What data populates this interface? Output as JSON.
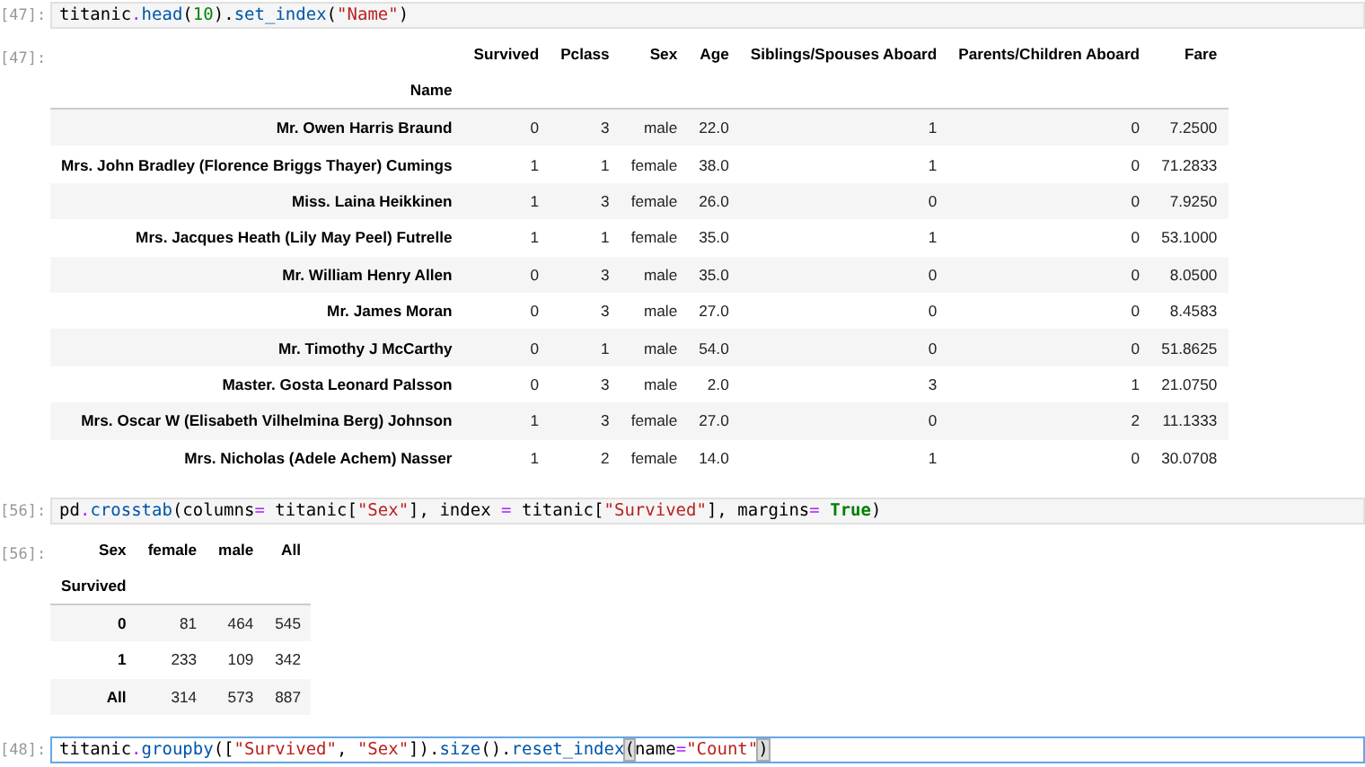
{
  "cells": [
    {
      "prompt": "[47]:",
      "selected": false,
      "code": [
        {
          "text": "titanic",
          "kind": "name"
        },
        {
          "text": ".",
          "kind": "op"
        },
        {
          "text": "head",
          "kind": "call"
        },
        {
          "text": "(",
          "kind": "punct"
        },
        {
          "text": "10",
          "kind": "number"
        },
        {
          "text": ").",
          "kind": "punct"
        },
        {
          "text": "set_index",
          "kind": "call"
        },
        {
          "text": "(",
          "kind": "punct"
        },
        {
          "text": "\"Name\"",
          "kind": "string"
        },
        {
          "text": ")",
          "kind": "punct"
        }
      ],
      "output": {
        "prompt": "[47]:",
        "table": {
          "columns": [
            "Survived",
            "Pclass",
            "Sex",
            "Age",
            "Siblings/Spouses Aboard",
            "Parents/Children Aboard",
            "Fare"
          ],
          "index_name": "Name",
          "rows": [
            {
              "index": "Mr. Owen Harris Braund",
              "cells": [
                "0",
                "3",
                "male",
                "22.0",
                "1",
                "0",
                "7.2500"
              ]
            },
            {
              "index": "Mrs. John Bradley (Florence Briggs Thayer) Cumings",
              "cells": [
                "1",
                "1",
                "female",
                "38.0",
                "1",
                "0",
                "71.2833"
              ]
            },
            {
              "index": "Miss. Laina Heikkinen",
              "cells": [
                "1",
                "3",
                "female",
                "26.0",
                "0",
                "0",
                "7.9250"
              ]
            },
            {
              "index": "Mrs. Jacques Heath (Lily May Peel) Futrelle",
              "cells": [
                "1",
                "1",
                "female",
                "35.0",
                "1",
                "0",
                "53.1000"
              ]
            },
            {
              "index": "Mr. William Henry Allen",
              "cells": [
                "0",
                "3",
                "male",
                "35.0",
                "0",
                "0",
                "8.0500"
              ]
            },
            {
              "index": "Mr. James Moran",
              "cells": [
                "0",
                "3",
                "male",
                "27.0",
                "0",
                "0",
                "8.4583"
              ]
            },
            {
              "index": "Mr. Timothy J McCarthy",
              "cells": [
                "0",
                "1",
                "male",
                "54.0",
                "0",
                "0",
                "51.8625"
              ]
            },
            {
              "index": "Master. Gosta Leonard Palsson",
              "cells": [
                "0",
                "3",
                "male",
                "2.0",
                "3",
                "1",
                "21.0750"
              ]
            },
            {
              "index": "Mrs. Oscar W (Elisabeth Vilhelmina Berg) Johnson",
              "cells": [
                "1",
                "3",
                "female",
                "27.0",
                "0",
                "2",
                "11.1333"
              ]
            },
            {
              "index": "Mrs. Nicholas (Adele Achem) Nasser",
              "cells": [
                "1",
                "2",
                "female",
                "14.0",
                "1",
                "0",
                "30.0708"
              ]
            }
          ]
        }
      }
    },
    {
      "prompt": "[56]:",
      "selected": false,
      "code": [
        {
          "text": "pd",
          "kind": "name"
        },
        {
          "text": ".",
          "kind": "op"
        },
        {
          "text": "crosstab",
          "kind": "call"
        },
        {
          "text": "(columns",
          "kind": "punct"
        },
        {
          "text": "=",
          "kind": "op"
        },
        {
          "text": " titanic[",
          "kind": "punct"
        },
        {
          "text": "\"Sex\"",
          "kind": "string"
        },
        {
          "text": "], index ",
          "kind": "punct"
        },
        {
          "text": "=",
          "kind": "op"
        },
        {
          "text": " titanic[",
          "kind": "punct"
        },
        {
          "text": "\"Survived\"",
          "kind": "string"
        },
        {
          "text": "], margins",
          "kind": "punct"
        },
        {
          "text": "=",
          "kind": "op"
        },
        {
          "text": " True",
          "kind": "keyword"
        },
        {
          "text": ")",
          "kind": "punct"
        }
      ],
      "output": {
        "prompt": "[56]:",
        "table": {
          "columns_label": "Sex",
          "columns": [
            "female",
            "male",
            "All"
          ],
          "index_name": "Survived",
          "rows": [
            {
              "index": "0",
              "cells": [
                "81",
                "464",
                "545"
              ]
            },
            {
              "index": "1",
              "cells": [
                "233",
                "109",
                "342"
              ]
            },
            {
              "index": "All",
              "cells": [
                "314",
                "573",
                "887"
              ]
            }
          ]
        }
      }
    },
    {
      "prompt": "[48]:",
      "selected": true,
      "code": [
        {
          "text": "titanic",
          "kind": "name"
        },
        {
          "text": ".",
          "kind": "op"
        },
        {
          "text": "groupby",
          "kind": "call"
        },
        {
          "text": "([",
          "kind": "punct"
        },
        {
          "text": "\"Survived\"",
          "kind": "string"
        },
        {
          "text": ", ",
          "kind": "punct"
        },
        {
          "text": "\"Sex\"",
          "kind": "string"
        },
        {
          "text": "]).",
          "kind": "punct"
        },
        {
          "text": "size",
          "kind": "call"
        },
        {
          "text": "().",
          "kind": "punct"
        },
        {
          "text": "reset_index",
          "kind": "call"
        },
        {
          "text": "(",
          "kind": "match"
        },
        {
          "text": "name",
          "kind": "name"
        },
        {
          "text": "=",
          "kind": "op"
        },
        {
          "text": "\"Count\"",
          "kind": "string"
        },
        {
          "text": ")",
          "kind": "match"
        }
      ]
    }
  ]
}
